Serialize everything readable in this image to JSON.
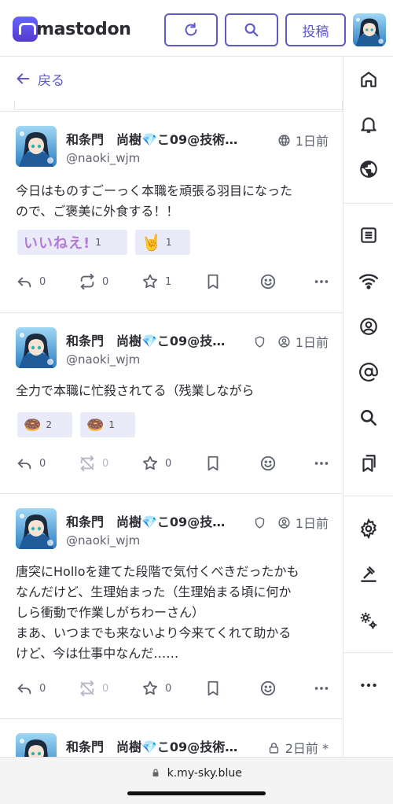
{
  "app": {
    "logo_text": "mastodon",
    "brand_color": "#6364ff"
  },
  "header": {
    "refresh_icon": "refresh-icon",
    "search_icon": "search-icon",
    "post_label": "投稿"
  },
  "back": {
    "label": "戻る"
  },
  "nav": {
    "items": [
      "home-icon",
      "bell-icon",
      "globe-icon",
      "list-icon",
      "wifi-icon",
      "profile-icon",
      "at-icon",
      "search-icon",
      "bookmarks-icon",
      "gear-icon",
      "hammer-icon",
      "preferences-icon",
      "more-icon"
    ]
  },
  "statuses": [
    {
      "name": "和条門　尚樹💎こ09@技術…",
      "handle": "@naoki_wjm",
      "visibility": "globe-icon",
      "time": "1日前",
      "body": [
        "今日はものすごーっく本職を頑張る羽目になった",
        "ので、ご褒美に外食する！！"
      ],
      "reactions": [
        {
          "emoji": "いいねえ!",
          "count": "1"
        },
        {
          "emoji": "🤘",
          "count": "1"
        }
      ],
      "replies": "0",
      "boosts": "0",
      "favs": "1",
      "boost_disabled": false
    },
    {
      "name": "和条門　尚樹💎こ09@技…",
      "handle": "@naoki_wjm",
      "visibility": "unlisted-icon",
      "time": "1日前",
      "body": [
        "全力で本職に忙殺されてる（残業しながら"
      ],
      "reactions": [
        {
          "emoji": "🍩",
          "count": "2"
        },
        {
          "emoji": "🍩",
          "count": "1"
        }
      ],
      "replies": "0",
      "boosts": "0",
      "favs": "0",
      "boost_disabled": true
    },
    {
      "name": "和条門　尚樹💎こ09@技…",
      "handle": "@naoki_wjm",
      "visibility": "unlisted-icon",
      "time": "1日前",
      "body": [
        "唐突にHolloを建てた段階で気付くべきだったかも",
        "なんだけど、生理始まった（生理始まる頃に何か",
        "しら衝動で作業しがちわーさん）",
        "まあ、いつまでも来ないより今来てくれて助かる",
        "けど、今は仕事中なんだ……"
      ],
      "reactions": [],
      "replies": "0",
      "boosts": "0",
      "favs": "0",
      "boost_disabled": true
    },
    {
      "name": "和条門　尚樹💎こ09@技術…",
      "time": "2日前 *",
      "visibility": "lock-icon"
    }
  ],
  "browser": {
    "url": "k.my-sky.blue"
  }
}
